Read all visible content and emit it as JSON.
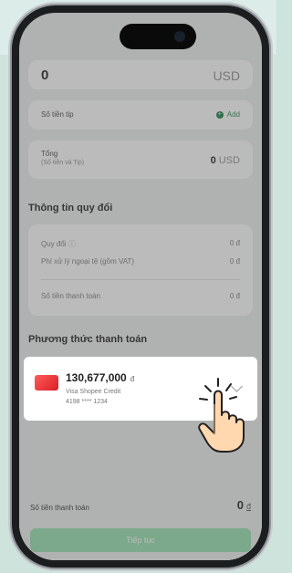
{
  "amount": {
    "value": "0",
    "currency": "USD"
  },
  "tip": {
    "label": "Số tiền tip",
    "add_label": "Add"
  },
  "total": {
    "label": "Tổng",
    "sub_label": "(Số tiền và Tip)",
    "value": "0",
    "currency": "USD"
  },
  "conversion": {
    "title": "Thông tin quy đổi",
    "rows": [
      {
        "label": "Quy đổi",
        "value": "0 đ"
      },
      {
        "label": "Phí xử lý ngoại tệ (gồm VAT)",
        "value": "0 đ"
      },
      {
        "label": "Số tiền thanh toán",
        "value": "0 đ"
      }
    ]
  },
  "payment": {
    "title": "Phương thức thanh toán",
    "card": {
      "amount": "130,677,000",
      "currency": "đ",
      "name": "Visa Shopee Credit",
      "number": "4198 **** 1234"
    }
  },
  "footer": {
    "total_label": "Số tiền thanh toán",
    "total_value": "0",
    "total_currency": "đ",
    "continue_label": "Tiếp tục"
  },
  "colors": {
    "accent": "#2e8b57",
    "cta": "#9fe3b6",
    "card": "#e52b2b"
  },
  "icons": [
    "info-icon",
    "add-icon",
    "chevron-down-icon",
    "credit-card-icon",
    "tap-hand-icon"
  ]
}
